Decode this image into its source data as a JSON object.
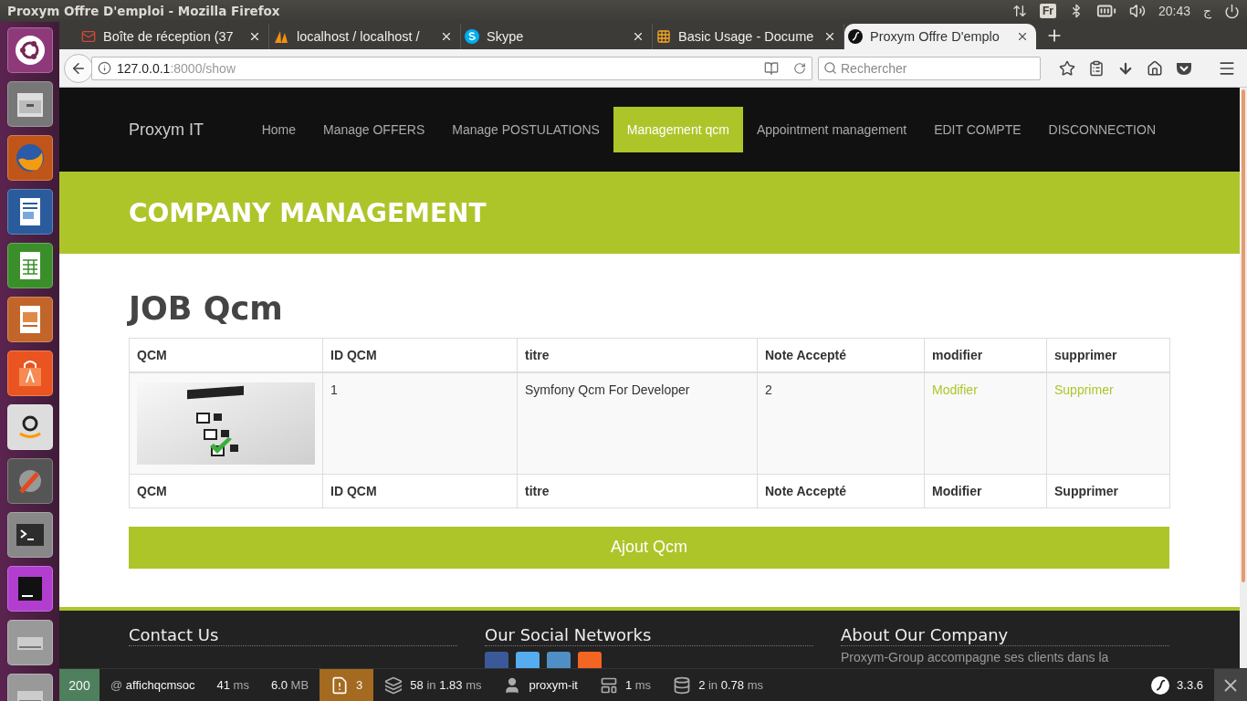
{
  "system_bar": {
    "title": "Proxym Offre D'emploi - Mozilla Firefox",
    "keyboard": "Fr",
    "time": "20:43",
    "user": "ج"
  },
  "browser": {
    "tabs": [
      {
        "kind": "mail",
        "label": "Boîte de réception (37",
        "selected": false
      },
      {
        "kind": "pma",
        "label": "localhost / localhost /",
        "selected": false
      },
      {
        "kind": "skype",
        "label": "Skype",
        "selected": false
      },
      {
        "kind": "docs",
        "label": "Basic Usage - Docume",
        "selected": false
      },
      {
        "kind": "symfony",
        "label": "Proxym Offre D'emplo",
        "selected": true
      }
    ],
    "url_host": "127.0.0.1",
    "url_rest": ":8000/show",
    "search_placeholder": "Rechercher"
  },
  "site": {
    "brand": "Proxym IT",
    "nav": [
      {
        "label": "Home",
        "selected": false
      },
      {
        "label": "Manage OFFERS",
        "selected": false
      },
      {
        "label": "Manage POSTULATIONS",
        "selected": false
      },
      {
        "label": "Management qcm",
        "selected": true
      },
      {
        "label": "Appointment management",
        "selected": false
      },
      {
        "label": "EDIT COMPTE",
        "selected": false
      },
      {
        "label": "DISCONNECTION",
        "selected": false
      }
    ],
    "banner": "COMPANY MANAGEMENT",
    "heading": "JOB Qcm",
    "table": {
      "columns": [
        "QCM",
        "ID QCM",
        "titre",
        "Note Accepté",
        "modifier",
        "supprimer"
      ],
      "rows": [
        {
          "id": "1",
          "title": "Symfony Qcm For Developer",
          "note": "2",
          "edit": "Modifier",
          "delete": "Supprimer"
        }
      ],
      "footer": [
        "QCM",
        "ID QCM",
        "titre",
        "Note Accepté",
        "Modifier",
        "Supprimer"
      ]
    },
    "add_button": "Ajout Qcm",
    "footer": {
      "contact_title": "Contact Us",
      "social_title": "Our Social Networks",
      "social": [
        {
          "kind": "facebook"
        },
        {
          "kind": "twitter"
        },
        {
          "kind": "linkedin"
        },
        {
          "kind": "rss"
        }
      ],
      "about_title": "About Our Company",
      "about_text": "Proxym-Group accompagne ses clients dans la"
    }
  },
  "debug_bar": {
    "status": "200",
    "route": {
      "prefix": "@",
      "name": "affichqcmsoc"
    },
    "metrics": [
      {
        "kind": "plain",
        "segments": [
          "41",
          "ms"
        ]
      },
      {
        "kind": "plain",
        "segments": [
          "6.0",
          "MB"
        ]
      },
      {
        "kind": "warning",
        "segments": [
          "3"
        ]
      },
      {
        "kind": "layers",
        "segments": [
          "58",
          "in",
          "1.83",
          "ms"
        ]
      },
      {
        "kind": "user",
        "segments": [
          "proxym-it"
        ]
      },
      {
        "kind": "template",
        "segments": [
          "1",
          "ms"
        ]
      },
      {
        "kind": "database",
        "segments": [
          "2",
          "in",
          "0.78",
          "ms"
        ]
      }
    ],
    "version": "3.3.6"
  }
}
